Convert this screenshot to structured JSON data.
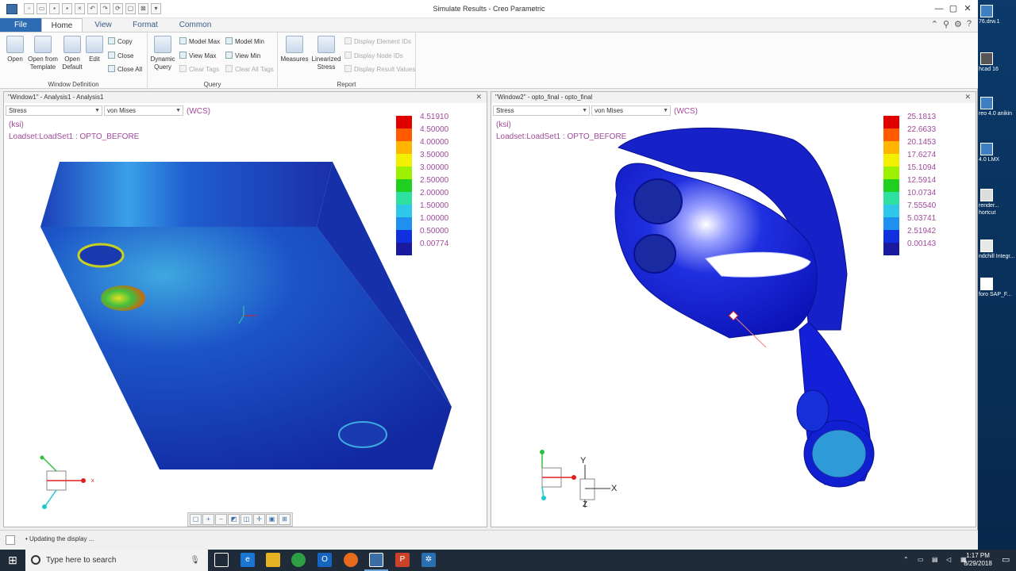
{
  "app": {
    "window_title": "Simulate Results - Creo Parametric",
    "quick_access": [
      "new",
      "open",
      "save",
      "undo",
      "redo",
      "regenerate",
      "windows",
      "close"
    ]
  },
  "ribbon_tabs": [
    "File",
    "Home",
    "View",
    "Format",
    "Common"
  ],
  "ribbon": {
    "window_definition": {
      "label": "Window Definition",
      "open": "Open",
      "open_from_template": "Open from Template",
      "open_default": "Open Default",
      "edit": "Edit",
      "copy": "Copy",
      "close": "Close",
      "close_all": "Close All"
    },
    "query": {
      "label": "Query",
      "dynamic_query": "Dynamic Query",
      "model_max": "Model Max",
      "model_min": "Model Min",
      "view_max": "View Max",
      "view_min": "View Min",
      "clear_tags": "Clear Tags",
      "clear_all_tags": "Clear All Tags"
    },
    "report": {
      "label": "Report",
      "measures": "Measures",
      "linearized_stress": "Linearized Stress",
      "display_element_ids": "Display Element IDs",
      "display_node_ids": "Display Node IDs",
      "display_result_values": "Display Result Values"
    }
  },
  "window1": {
    "header": "\"Window1\" - Analysis1 - Analysis1",
    "quantity": "Stress",
    "component": "von Mises",
    "wcs": "(WCS)",
    "units": "(ksi)",
    "loadset": "Loadset:LoadSet1 :  OPTO_BEFORE",
    "legend_values": [
      "4.51910",
      "4.50000",
      "4.00000",
      "3.50000",
      "3.00000",
      "2.50000",
      "2.00000",
      "1.50000",
      "1.00000",
      "0.50000",
      "0.00774"
    ],
    "axis_x": "x"
  },
  "window2": {
    "header": "\"Window2\" - opto_final - opto_final",
    "quantity": "Stress",
    "component": "von Mises",
    "wcs": "(WCS)",
    "units": "(ksi)",
    "loadset": "Loadset:LoadSet1 :  OPTO_BEFORE",
    "legend_values": [
      "25.1813",
      "22.6633",
      "20.1453",
      "17.6274",
      "15.1094",
      "12.5914",
      "10.0734",
      "7.55540",
      "5.03741",
      "2.51942",
      "0.00143"
    ],
    "axis_y": "Y",
    "axis_x": "X",
    "axis_z": "Z"
  },
  "legend_colors": [
    "#e00000",
    "#ff5a00",
    "#ffb400",
    "#f0f000",
    "#9cf000",
    "#20d020",
    "#30e0a0",
    "#30c8e8",
    "#2090f0",
    "#1030e0",
    "#1a1aa0"
  ],
  "status": {
    "message": "Updating the display ..."
  },
  "desktop_icons": [
    "76.drw.1",
    "hcad 16",
    "reo 4.0 anikin",
    "4.0 LMX",
    "render... hortcut",
    "ndchill Integr...",
    "foro SAP_F..."
  ],
  "taskbar": {
    "search_placeholder": "Type here to search",
    "time": "1:17 PM",
    "date": "8/29/2018"
  }
}
